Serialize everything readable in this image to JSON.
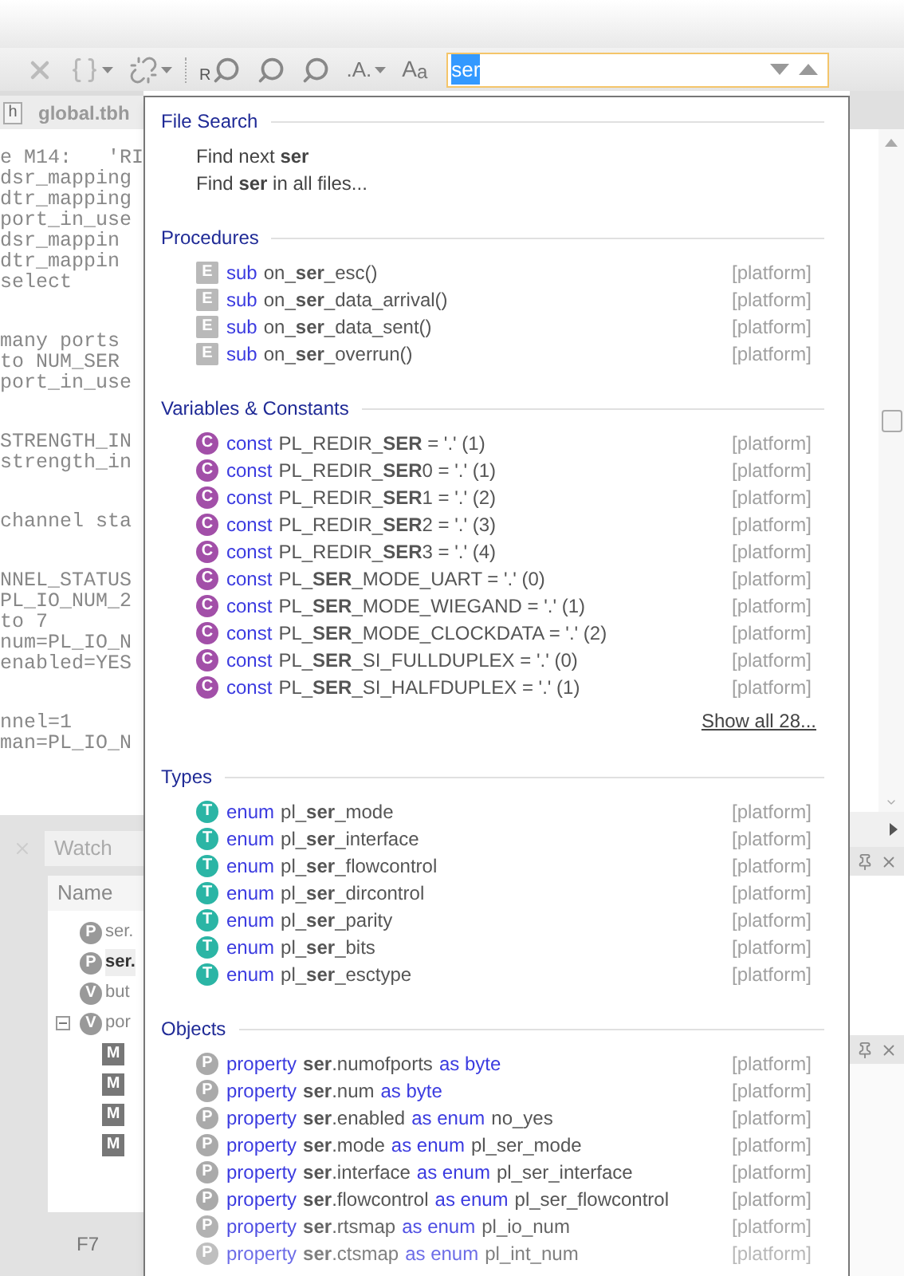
{
  "toolbar": {
    "buttons": [
      {
        "kind": "close",
        "dropdown": false
      },
      {
        "kind": "braces",
        "dropdown": true
      },
      {
        "kind": "unlink",
        "dropdown": true
      },
      {
        "kind": "find-letter",
        "letter": "R",
        "dropdown": false
      },
      {
        "kind": "find-down",
        "dropdown": false
      },
      {
        "kind": "find-up",
        "dropdown": false
      },
      {
        "kind": "match",
        "label": ".A.",
        "dropdown": true
      },
      {
        "kind": "case",
        "label": "A",
        "sub": "a",
        "dropdown": false
      }
    ],
    "search": {
      "value": "ser",
      "selected": true
    }
  },
  "editor": {
    "tab": {
      "label": "global.tbh",
      "icon_letter": "h"
    },
    "code_blocks": [
      [
        "e M14:   'RI",
        "dsr_mapping",
        "dtr_mapping",
        "port_in_use",
        "dsr_mappin",
        "dtr_mappin",
        "select"
      ],
      [
        "many ports",
        "to NUM_SER",
        "port_in_use"
      ],
      [
        "STRENGTH_IN",
        "strength_in"
      ],
      [
        "channel sta"
      ],
      [
        "NNEL_STATUS",
        "PL_IO_NUM_2",
        "to 7",
        "num=PL_IO_N",
        "enabled=YES"
      ],
      [
        "nnel=1",
        "man=PL_IO_N"
      ]
    ]
  },
  "watch": {
    "tab": "Watch",
    "column": "Name",
    "rows": [
      {
        "icon": "P",
        "text": "ser.",
        "selected": false
      },
      {
        "icon": "P",
        "text": "ser.",
        "selected": true
      },
      {
        "icon": "V",
        "text": "but",
        "selected": false
      },
      {
        "icon": "V",
        "text": "por",
        "selected": false,
        "expanded": true,
        "children": [
          {
            "icon": "M"
          },
          {
            "icon": "M"
          },
          {
            "icon": "M"
          },
          {
            "icon": "M"
          }
        ]
      }
    ]
  },
  "status": {
    "text": "F7"
  },
  "popup": {
    "sections": [
      {
        "title": "File Search",
        "kind": "command",
        "rows": [
          {
            "text": "Find next **ser**"
          },
          {
            "text": "Find **ser** in all files..."
          }
        ]
      },
      {
        "title": "Procedures",
        "kind": "sub",
        "rows": [
          {
            "icon": "E",
            "parts": [
              {
                "kind": "keyword",
                "text": "sub"
              },
              {
                "kind": "name",
                "text": "on_**ser**_esc()"
              }
            ],
            "scope": "[platform]"
          },
          {
            "icon": "E",
            "parts": [
              {
                "kind": "keyword",
                "text": "sub"
              },
              {
                "kind": "name",
                "text": "on_**ser**_data_arrival()"
              }
            ],
            "scope": "[platform]"
          },
          {
            "icon": "E",
            "parts": [
              {
                "kind": "keyword",
                "text": "sub"
              },
              {
                "kind": "name",
                "text": "on_**ser**_data_sent()"
              }
            ],
            "scope": "[platform]"
          },
          {
            "icon": "E",
            "parts": [
              {
                "kind": "keyword",
                "text": "sub"
              },
              {
                "kind": "name",
                "text": "on_**ser**_overrun()"
              }
            ],
            "scope": "[platform]"
          }
        ]
      },
      {
        "title": "Variables & Constants",
        "kind": "const",
        "more": "Show all 28...",
        "rows": [
          {
            "icon": "C",
            "parts": [
              {
                "kind": "keyword",
                "text": "const"
              },
              {
                "kind": "name",
                "text": "PL_REDIR_**SER** = '.' (1)"
              }
            ],
            "scope": "[platform]"
          },
          {
            "icon": "C",
            "parts": [
              {
                "kind": "keyword",
                "text": "const"
              },
              {
                "kind": "name",
                "text": "PL_REDIR_**SER**0 = '.' (1)"
              }
            ],
            "scope": "[platform]"
          },
          {
            "icon": "C",
            "parts": [
              {
                "kind": "keyword",
                "text": "const"
              },
              {
                "kind": "name",
                "text": "PL_REDIR_**SER**1 = '.' (2)"
              }
            ],
            "scope": "[platform]"
          },
          {
            "icon": "C",
            "parts": [
              {
                "kind": "keyword",
                "text": "const"
              },
              {
                "kind": "name",
                "text": "PL_REDIR_**SER**2 = '.' (3)"
              }
            ],
            "scope": "[platform]"
          },
          {
            "icon": "C",
            "parts": [
              {
                "kind": "keyword",
                "text": "const"
              },
              {
                "kind": "name",
                "text": "PL_REDIR_**SER**3 = '.' (4)"
              }
            ],
            "scope": "[platform]"
          },
          {
            "icon": "C",
            "parts": [
              {
                "kind": "keyword",
                "text": "const"
              },
              {
                "kind": "name",
                "text": "PL_**SER**_MODE_UART = '.' (0)"
              }
            ],
            "scope": "[platform]"
          },
          {
            "icon": "C",
            "parts": [
              {
                "kind": "keyword",
                "text": "const"
              },
              {
                "kind": "name",
                "text": "PL_**SER**_MODE_WIEGAND = '.' (1)"
              }
            ],
            "scope": "[platform]"
          },
          {
            "icon": "C",
            "parts": [
              {
                "kind": "keyword",
                "text": "const"
              },
              {
                "kind": "name",
                "text": "PL_**SER**_MODE_CLOCKDATA = '.' (2)"
              }
            ],
            "scope": "[platform]"
          },
          {
            "icon": "C",
            "parts": [
              {
                "kind": "keyword",
                "text": "const"
              },
              {
                "kind": "name",
                "text": "PL_**SER**_SI_FULLDUPLEX = '.' (0)"
              }
            ],
            "scope": "[platform]"
          },
          {
            "icon": "C",
            "parts": [
              {
                "kind": "keyword",
                "text": "const"
              },
              {
                "kind": "name",
                "text": "PL_**SER**_SI_HALFDUPLEX = '.' (1)"
              }
            ],
            "scope": "[platform]"
          }
        ]
      },
      {
        "title": "Types",
        "kind": "enum",
        "rows": [
          {
            "icon": "T",
            "parts": [
              {
                "kind": "keyword",
                "text": "enum"
              },
              {
                "kind": "name",
                "text": "pl_**ser**_mode"
              }
            ],
            "scope": "[platform]"
          },
          {
            "icon": "T",
            "parts": [
              {
                "kind": "keyword",
                "text": "enum"
              },
              {
                "kind": "name",
                "text": "pl_**ser**_interface"
              }
            ],
            "scope": "[platform]"
          },
          {
            "icon": "T",
            "parts": [
              {
                "kind": "keyword",
                "text": "enum"
              },
              {
                "kind": "name",
                "text": "pl_**ser**_flowcontrol"
              }
            ],
            "scope": "[platform]"
          },
          {
            "icon": "T",
            "parts": [
              {
                "kind": "keyword",
                "text": "enum"
              },
              {
                "kind": "name",
                "text": "pl_**ser**_dircontrol"
              }
            ],
            "scope": "[platform]"
          },
          {
            "icon": "T",
            "parts": [
              {
                "kind": "keyword",
                "text": "enum"
              },
              {
                "kind": "name",
                "text": "pl_**ser**_parity"
              }
            ],
            "scope": "[platform]"
          },
          {
            "icon": "T",
            "parts": [
              {
                "kind": "keyword",
                "text": "enum"
              },
              {
                "kind": "name",
                "text": "pl_**ser**_bits"
              }
            ],
            "scope": "[platform]"
          },
          {
            "icon": "T",
            "parts": [
              {
                "kind": "keyword",
                "text": "enum"
              },
              {
                "kind": "name",
                "text": "pl_**ser**_esctype"
              }
            ],
            "scope": "[platform]"
          }
        ]
      },
      {
        "title": "Objects",
        "kind": "property",
        "rows": [
          {
            "icon": "P",
            "parts": [
              {
                "kind": "keyword",
                "text": "property"
              },
              {
                "kind": "name",
                "text": "**ser**.numofports"
              },
              {
                "kind": "keyword",
                "text": "as byte"
              }
            ],
            "scope": "[platform]"
          },
          {
            "icon": "P",
            "parts": [
              {
                "kind": "keyword",
                "text": "property"
              },
              {
                "kind": "name",
                "text": "**ser**.num"
              },
              {
                "kind": "keyword",
                "text": "as byte"
              }
            ],
            "scope": "[platform]"
          },
          {
            "icon": "P",
            "parts": [
              {
                "kind": "keyword",
                "text": "property"
              },
              {
                "kind": "name",
                "text": "**ser**.enabled"
              },
              {
                "kind": "keyword",
                "text": "as enum"
              },
              {
                "kind": "name",
                "text": "no_yes"
              }
            ],
            "scope": "[platform]"
          },
          {
            "icon": "P",
            "parts": [
              {
                "kind": "keyword",
                "text": "property"
              },
              {
                "kind": "name",
                "text": "**ser**.mode"
              },
              {
                "kind": "keyword",
                "text": "as enum"
              },
              {
                "kind": "name",
                "text": "pl_ser_mode"
              }
            ],
            "scope": "[platform]"
          },
          {
            "icon": "P",
            "parts": [
              {
                "kind": "keyword",
                "text": "property"
              },
              {
                "kind": "name",
                "text": "**ser**.interface"
              },
              {
                "kind": "keyword",
                "text": "as enum"
              },
              {
                "kind": "name",
                "text": "pl_ser_interface"
              }
            ],
            "scope": "[platform]"
          },
          {
            "icon": "P",
            "parts": [
              {
                "kind": "keyword",
                "text": "property"
              },
              {
                "kind": "name",
                "text": "**ser**.flowcontrol"
              },
              {
                "kind": "keyword",
                "text": "as enum"
              },
              {
                "kind": "name",
                "text": "pl_ser_flowcontrol"
              }
            ],
            "scope": "[platform]"
          },
          {
            "icon": "P",
            "parts": [
              {
                "kind": "keyword",
                "text": "property"
              },
              {
                "kind": "name",
                "text": "**ser**.rtsmap"
              },
              {
                "kind": "keyword",
                "text": "as enum"
              },
              {
                "kind": "name",
                "text": "pl_io_num"
              }
            ],
            "scope": "[platform]"
          },
          {
            "icon": "P",
            "parts": [
              {
                "kind": "keyword",
                "text": "property"
              },
              {
                "kind": "name",
                "text": "**ser**.ctsmap"
              },
              {
                "kind": "keyword",
                "text": "as enum"
              },
              {
                "kind": "name",
                "text": "pl_int_num"
              }
            ],
            "scope": "[platform]"
          }
        ]
      }
    ]
  }
}
